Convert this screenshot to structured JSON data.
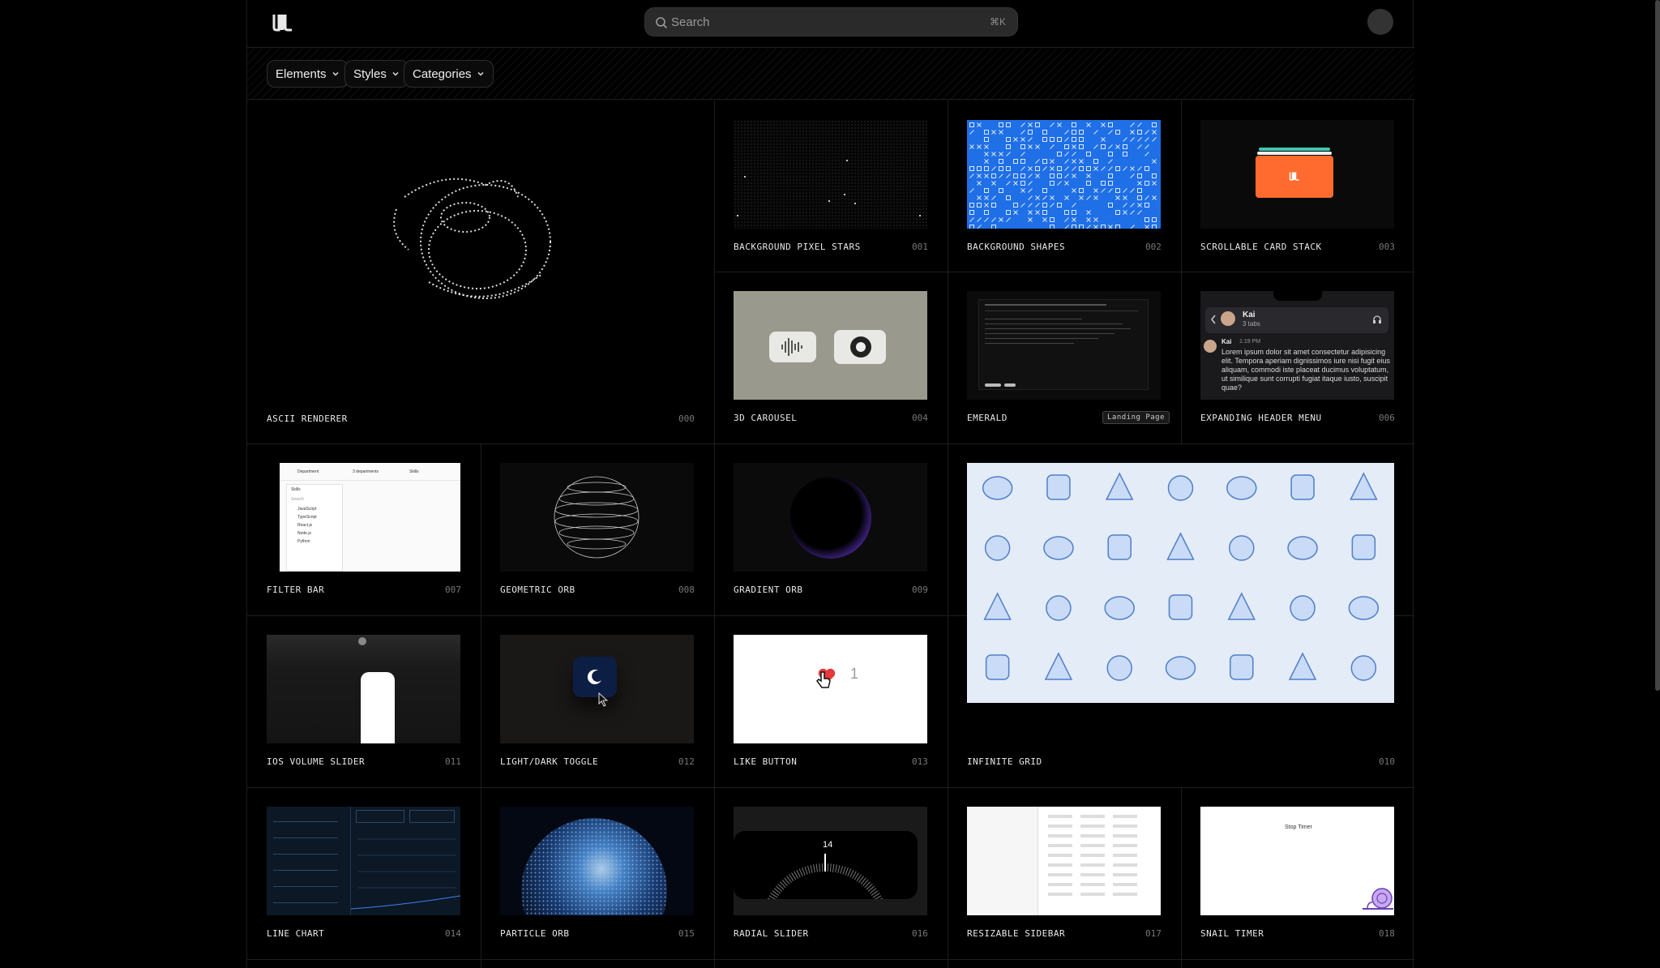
{
  "header": {
    "search_placeholder": "Search",
    "search_shortcut": "⌘K",
    "logo_icon": "brand-logo-icon",
    "avatar_icon": "user-avatar"
  },
  "filters": [
    {
      "label": "Elements"
    },
    {
      "label": "Styles"
    },
    {
      "label": "Categories"
    }
  ],
  "cards": [
    {
      "title": "ASCII Renderer",
      "num": "000"
    },
    {
      "title": "Background Pixel Stars",
      "num": "001"
    },
    {
      "title": "Background Shapes",
      "num": "002"
    },
    {
      "title": "Scrollable Card Stack",
      "num": "003"
    },
    {
      "title": "3D Carousel",
      "num": "004"
    },
    {
      "title": "Emerald",
      "badge": "Landing Page"
    },
    {
      "title": "Expanding Header Menu",
      "num": "006"
    },
    {
      "title": "Filter Bar",
      "num": "007"
    },
    {
      "title": "Geometric Orb",
      "num": "008"
    },
    {
      "title": "Gradient Orb",
      "num": "009"
    },
    {
      "title": "Infinite Grid",
      "num": "010"
    },
    {
      "title": "iOS Volume Slider",
      "num": "011"
    },
    {
      "title": "Light/Dark Toggle",
      "num": "012"
    },
    {
      "title": "Like Button",
      "num": "013"
    },
    {
      "title": "Line Chart",
      "num": "014"
    },
    {
      "title": "Particle Orb",
      "num": "015"
    },
    {
      "title": "Radial Slider",
      "num": "016"
    },
    {
      "title": "Resizable Sidebar",
      "num": "017"
    },
    {
      "title": "Snail Timer",
      "num": "018"
    }
  ],
  "previews": {
    "header_menu": {
      "name": "Kai",
      "tabs": "3 tabs",
      "time": "1:19 PM",
      "message": "Lorem ipsum dolor sit amet consectetur adipisicing elit. Tempora aperiam dignissimos iure nisi fugit eius aliquam, commodi iste placeat ducimus voluptatum, ut similique sunt corrupti fugiat itaque iusto, suscipit quae?"
    },
    "filter_bar": {
      "tokens": [
        "Department",
        "3 departments",
        "Skills"
      ],
      "menu_title": "Skills",
      "menu_search": "Search",
      "items": [
        "JavaScript",
        "TypeScript",
        "React.js",
        "Node.js",
        "Python"
      ]
    },
    "like_count": "1",
    "radial_value": "14",
    "snail_timer": "Stop Timer",
    "colors": {
      "accent_blue": "#1f6fe6",
      "card_orange": "#ff6a2e",
      "gradient_orb": "#8c5cff"
    }
  }
}
